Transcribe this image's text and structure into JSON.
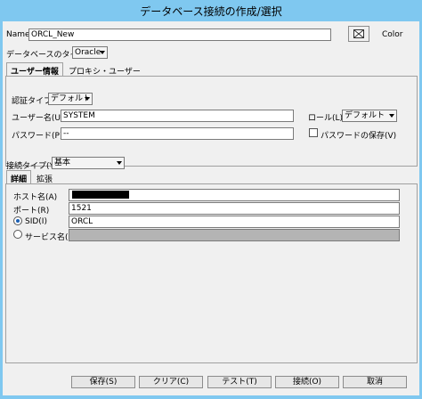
{
  "window": {
    "title": "データベース接続の作成/選択"
  },
  "form": {
    "name_label": "Name",
    "name_value": "ORCL_New",
    "color_label": "Color",
    "db_type_label": "データベースのタイプ",
    "db_type_value": "Oracle",
    "tabs": [
      "ユーザー情報",
      "プロキシ・ユーザー"
    ],
    "auth_type_label": "認証タイプ",
    "auth_type_value": "デフォルト",
    "username_label": "ユーザー名(U)",
    "username_value": "SYSTEM",
    "role_label": "ロール(L)",
    "role_value": "デフォルト",
    "password_label": "パスワード(P)",
    "password_value": "--",
    "save_password_label": "パスワードの保存(V)",
    "save_password_checked": false,
    "conn_type_label": "接続タイプ(Y)",
    "conn_type_value": "基本",
    "detail_tabs": [
      "詳細",
      "拡張"
    ],
    "host_label": "ホスト名(A)",
    "port_label": "ポート(R)",
    "port_value": "1521",
    "sid_label": "SID(I)",
    "sid_value": "ORCL",
    "service_label": "サービス名(E)",
    "sid_selected": true
  },
  "buttons": {
    "save": "保存(S)",
    "clear": "クリア(C)",
    "test": "テスト(T)",
    "connect": "接続(O)",
    "cancel": "取消"
  }
}
